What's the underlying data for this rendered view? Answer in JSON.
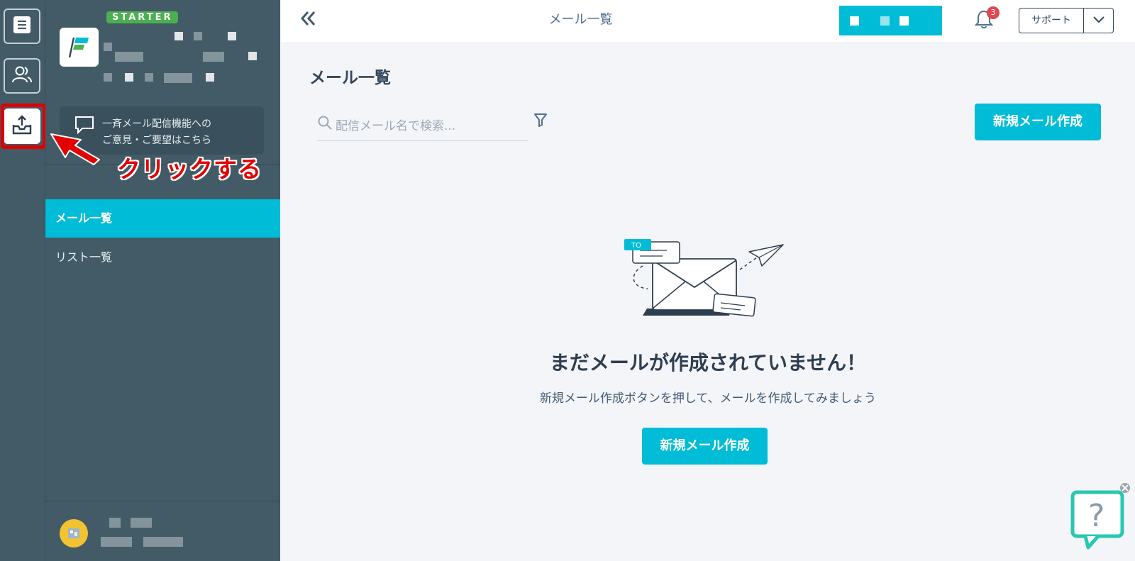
{
  "sidebar": {
    "plan_badge": "STARTER",
    "feedback_line1": "一斉メール配信機能への",
    "feedback_line2": "ご意見・ご要望はこちら",
    "nav_items": [
      {
        "label": "メール一覧",
        "active": true
      },
      {
        "label": "リスト一覧",
        "active": false
      }
    ]
  },
  "rail": {
    "icons": [
      "list-icon",
      "users-icon",
      "inbox-upload-icon"
    ],
    "active_index": 2
  },
  "annotation": {
    "text": "クリックする",
    "color": "#e30000"
  },
  "topbar": {
    "title": "メール一覧",
    "notification_count": "3",
    "support_label": "サポート"
  },
  "main": {
    "page_title": "メール一覧",
    "search_placeholder": "配信メール名で検索...",
    "new_mail_button": "新規メール作成",
    "empty": {
      "illustration_tag": "TO",
      "title": "まだメールが作成されていません！",
      "description": "新規メール作成ボタンを押して、メールを作成してみましょう",
      "button": "新規メール作成"
    }
  },
  "colors": {
    "accent": "#00bcd6",
    "sidebar": "#425b67",
    "plan_badge": "#4caf50",
    "notification": "#e0474c",
    "help_widget": "#29c7b0"
  }
}
